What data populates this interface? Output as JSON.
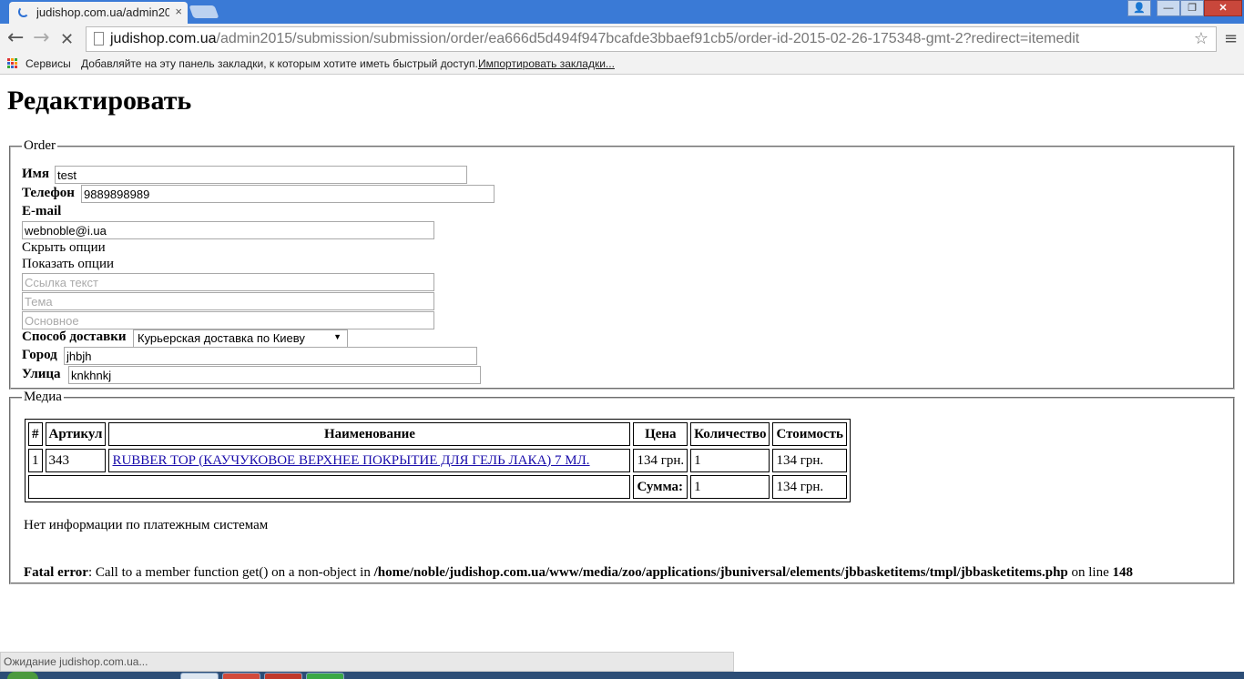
{
  "browser": {
    "tab_title": "judishop.com.ua/admin20",
    "tab_close": "×",
    "url_domain": "judishop.com.ua",
    "url_path": "/admin2015/submission/submission/order/ea666d5d494f947bcafde3bbaef91cb5/order-id-2015-02-26-175348-gmt-2?redirect=itemedit",
    "back_glyph": "←",
    "forward_glyph": "→",
    "stop_glyph": "✕",
    "star_glyph": "☆",
    "menu_glyph": "≡",
    "icons": [
      "back-icon",
      "forward-icon",
      "stop-icon",
      "page-icon",
      "star-icon",
      "menu-icon",
      "apps-icon",
      "user-icon",
      "loading-spinner-icon"
    ],
    "window_controls": {
      "minimize": "—",
      "maximize": "❐",
      "close": "✕",
      "user": "👤"
    },
    "accent": "#3a7ad6"
  },
  "bookmarks": {
    "apps": "Сервисы",
    "hint": "Добавляйте на эту панель закладки, к которым хотите иметь быстрый доступ.",
    "import": "Импортировать закладки..."
  },
  "page": {
    "title": "Редактировать",
    "order_legend": "Order",
    "name_label": "Имя",
    "name_value": "test",
    "phone_label": "Телефон",
    "phone_value": "9889898989",
    "email_label": "E-mail",
    "email_value": "webnoble@i.ua",
    "hide_options": "Скрыть опции",
    "show_options": "Показать опции",
    "link_text_placeholder": "Ссылка текст",
    "subject_placeholder": "Тема",
    "main_placeholder": "Основное",
    "delivery_label": "Способ доставки",
    "delivery_value": "Курьерская доставка по Киеву",
    "city_label": "Город",
    "city_value": "jhbjh",
    "street_label": "Улица",
    "street_value": "knkhnkj"
  },
  "media": {
    "legend": "Медиа",
    "headers": {
      "num": "#",
      "sku": "Артикул",
      "name": "Наименование",
      "price": "Цена",
      "qty": "Количество",
      "cost": "Стоимость"
    },
    "rows": [
      {
        "num": "1",
        "sku": "343",
        "name": "RUBBER TOP (КАУЧУКОВОЕ ВЕРХНЕЕ ПОКРЫТИЕ ДЛЯ ГЕЛЬ ЛАКА) 7 МЛ.",
        "price": "134 грн.",
        "qty": "1",
        "cost": "134 грн."
      }
    ],
    "sum_label": "Сумма:",
    "sum_qty": "1",
    "sum_cost": "134 грн.",
    "payment_info": "Нет информации по платежным системам",
    "fatal_label": "Fatal error",
    "fatal_message": ": Call to a member function get() on a non-object in ",
    "fatal_path": "/home/noble/judishop.com.ua/www/media/zoo/applications/jbuniversal/elements/jbbasketitems/tmpl/jbbasketitems.php",
    "fatal_online": " on line ",
    "fatal_line": "148"
  },
  "status": {
    "text": "Ожидание judishop.com.ua..."
  }
}
